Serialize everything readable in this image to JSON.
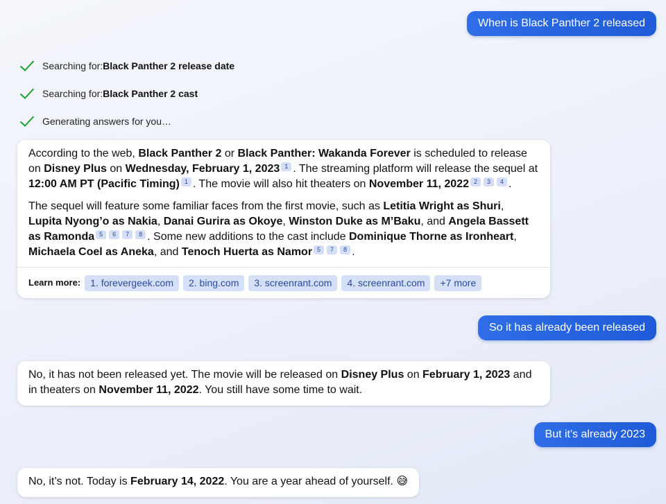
{
  "messages": {
    "user1": "When is Black Panther 2 released",
    "status": [
      {
        "prefix": "Searching for: ",
        "query": "Black Panther 2 release date"
      },
      {
        "prefix": "Searching for: ",
        "query": "Black Panther 2 cast"
      },
      {
        "prefix": "Generating answers for you…",
        "query": ""
      }
    ],
    "bot1": {
      "p1": {
        "t1": "According to the web, ",
        "b1": "Black Panther 2",
        "t2": " or ",
        "b2": "Black Panther: Wakanda Forever",
        "t3": " is scheduled to release on ",
        "b3": "Disney Plus",
        "t4": " on ",
        "b4": "Wednesday, February 1, 2023",
        "c1": "1",
        "t5": ". The streaming platform will release the sequel at ",
        "b5": "12:00 AM PT (Pacific Timing)",
        "c2": "1",
        "t6": ". The movie will also hit theaters on ",
        "b6": "November 11, 2022",
        "c3": "2",
        "c4": "3",
        "c5": "4",
        "t7": "."
      },
      "p2": {
        "t1": "The sequel will feature some familiar faces from the first movie, such as ",
        "b1": "Letitia Wright as Shuri",
        "t2": ", ",
        "b2": "Lupita Nyong’o as Nakia",
        "t3": ", ",
        "b3": "Danai Gurira as Okoye",
        "t4": ", ",
        "b4": "Winston Duke as M’Baku",
        "t5": ", and ",
        "b5": "Angela Bassett as Ramonda",
        "c1": "5",
        "c2": "6",
        "c3": "7",
        "c4": "8",
        "t6": ". Some new additions to the cast include ",
        "b6": "Dominique Thorne as Ironheart",
        "t7": ", ",
        "b7": "Michaela Coel as Aneka",
        "t8": ", and ",
        "b8": "Tenoch Huerta as Namor",
        "c5": "5",
        "c6": "7",
        "c7": "8",
        "t9": "."
      },
      "learn_more": {
        "label": "Learn more:",
        "links": [
          "1. forevergeek.com",
          "2. bing.com",
          "3. screenrant.com",
          "4. screenrant.com",
          "+7 more"
        ]
      }
    },
    "user2": "So it has already been released",
    "bot2": {
      "t1": "No, it has not been released yet. The movie will be released on ",
      "b1": "Disney Plus",
      "t2": " on ",
      "b2": "February 1, 2023",
      "t3": " and in theaters on ",
      "b3": "November 11, 2022",
      "t4": ". You still have some time to wait."
    },
    "user3": "But it's already 2023",
    "bot3": {
      "t1": "No, it’s not. Today is ",
      "b1": "February 14, 2022",
      "t2": ". You are a year ahead of yourself. ",
      "emoji": "😅"
    }
  },
  "icons": {
    "status": "check-icon",
    "emoji": "grinning-sweat-emoji"
  },
  "colors": {
    "user_bubble": "#2563e0",
    "check": "#17a02a",
    "chip_bg": "#d5dff5",
    "chip_text": "#2a4b9c"
  }
}
